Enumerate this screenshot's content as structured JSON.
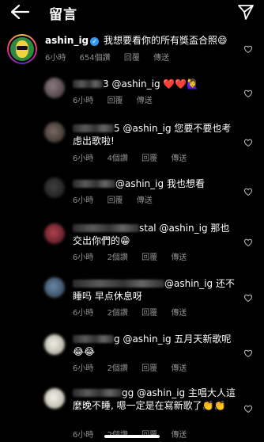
{
  "header": {
    "title": "留言"
  },
  "main_comment": {
    "username": "ashin_ig",
    "text": "我想要看你的所有獎盃合照😄",
    "time": "6小時",
    "likes": "654個讚",
    "reply": "回覆",
    "share": "傳送"
  },
  "replies": [
    {
      "user_suffix": "3",
      "mention": "@ashin_ig",
      "text": "❤️❤️🙋‍♀️",
      "time": "6小時",
      "likes": "",
      "reply": "回覆",
      "share": "傳送"
    },
    {
      "user_suffix": "5",
      "mention": "@ashin_ig",
      "text": "您要不要也考虑出歌啦!",
      "time": "6小時",
      "likes": "4個讚",
      "reply": "回覆",
      "share": "傳送"
    },
    {
      "user_suffix": "",
      "mention": "@ashin_ig",
      "text": "我也想看",
      "time": "6小時",
      "likes": "",
      "reply": "回覆",
      "share": "傳送"
    },
    {
      "user_suffix": "stal",
      "mention": "@ashin_ig",
      "text": "那也交出你們的😁",
      "time": "6小時",
      "likes": "2個讚",
      "reply": "回覆",
      "share": "傳送"
    },
    {
      "user_suffix": "",
      "mention": "@ashin_ig",
      "text": "还不睡吗 早点休息呀",
      "time": "6小時",
      "likes": "2個讚",
      "reply": "回覆",
      "share": "傳送"
    },
    {
      "user_suffix": "g",
      "mention": "@ashin_ig",
      "text": "五月天新歌呢😂😂",
      "time": "6小時",
      "likes": "2個讚",
      "reply": "回覆",
      "share": "傳送"
    },
    {
      "user_suffix": "gg",
      "mention": "@ashin_ig",
      "text": "主唱大人這麼晚不睡, 嗯一定是在寫新歌了👏👏",
      "time": "6小時",
      "likes": "2個讚",
      "reply": "回覆",
      "share": "傳送"
    }
  ]
}
